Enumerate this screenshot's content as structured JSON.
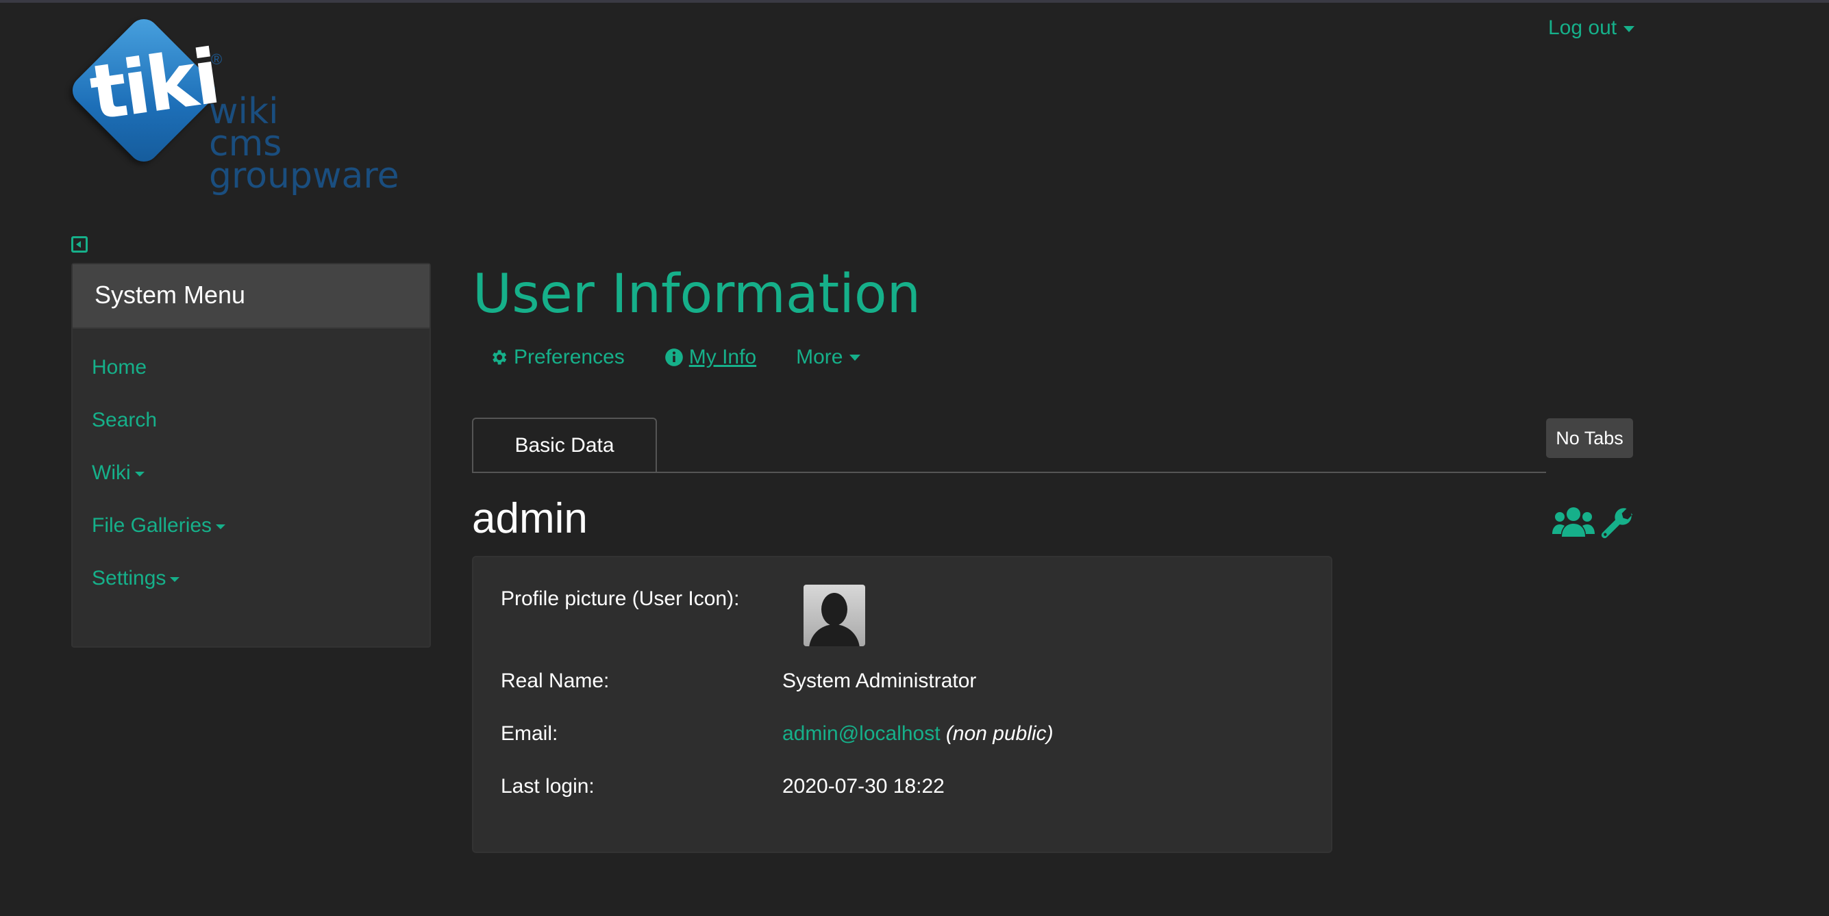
{
  "header": {
    "logo": {
      "word": "tiki",
      "registered": "®",
      "tagline": [
        "wiki",
        "cms",
        "groupware"
      ]
    },
    "logout_label": "Log out"
  },
  "sidebar": {
    "title": "System Menu",
    "items": [
      {
        "label": "Home",
        "dropdown": false
      },
      {
        "label": "Search",
        "dropdown": false
      },
      {
        "label": "Wiki",
        "dropdown": true
      },
      {
        "label": "File Galleries",
        "dropdown": true
      },
      {
        "label": "Settings",
        "dropdown": true
      }
    ]
  },
  "main": {
    "title": "User Information",
    "nav": {
      "preferences": "Preferences",
      "my_info": "My Info",
      "more": "More"
    },
    "tabs": [
      {
        "label": "Basic Data"
      }
    ],
    "no_tabs_label": "No Tabs",
    "username": "admin",
    "fields": {
      "profile_picture_label": "Profile picture (User Icon):",
      "real_name_label": "Real Name:",
      "real_name_value": "System Administrator",
      "email_label": "Email:",
      "email_value": "admin@localhost",
      "email_note": "(non public)",
      "last_login_label": "Last login:",
      "last_login_value": "2020-07-30 18:22"
    }
  },
  "colors": {
    "accent": "#16b08a",
    "background": "#222222",
    "panel": "#2e2e2e",
    "panel_header": "#444444"
  }
}
